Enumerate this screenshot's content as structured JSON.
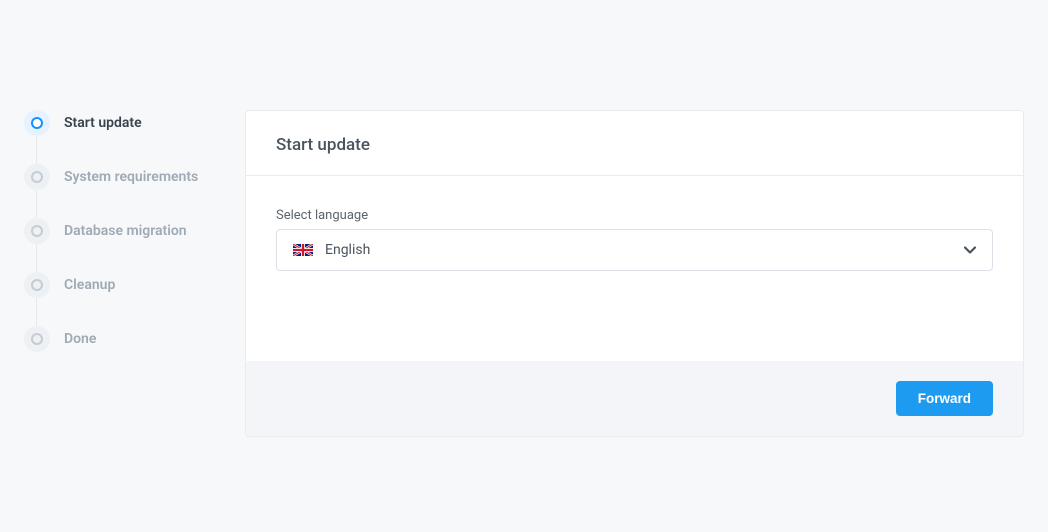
{
  "sidebar": {
    "steps": [
      {
        "label": "Start update",
        "active": true
      },
      {
        "label": "System requirements",
        "active": false
      },
      {
        "label": "Database migration",
        "active": false
      },
      {
        "label": "Cleanup",
        "active": false
      },
      {
        "label": "Done",
        "active": false
      }
    ]
  },
  "main": {
    "title": "Start update",
    "language_label": "Select language",
    "language_value": "English",
    "forward_button": "Forward"
  }
}
